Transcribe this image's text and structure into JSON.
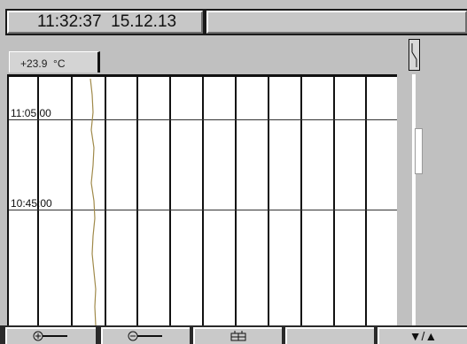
{
  "status": {
    "time": "11:32:37",
    "date": "15.12.13",
    "message": ""
  },
  "channel": {
    "value": "+23.9",
    "unit": "°C",
    "trace_color": "#a08a4a"
  },
  "chart": {
    "time_labels": [
      "11:05:00",
      "10:45:00"
    ]
  },
  "softkeys": {
    "zoom_in_icon": "zoom-in-icon",
    "zoom_out_icon": "zoom-out-icon",
    "device_icon": "connector-icon",
    "empty_label": "",
    "scroll_label": "▼/▲"
  },
  "colors": {
    "background": "#c0c0c0",
    "chart_bg": "#ffffff",
    "grid": "#111111"
  }
}
